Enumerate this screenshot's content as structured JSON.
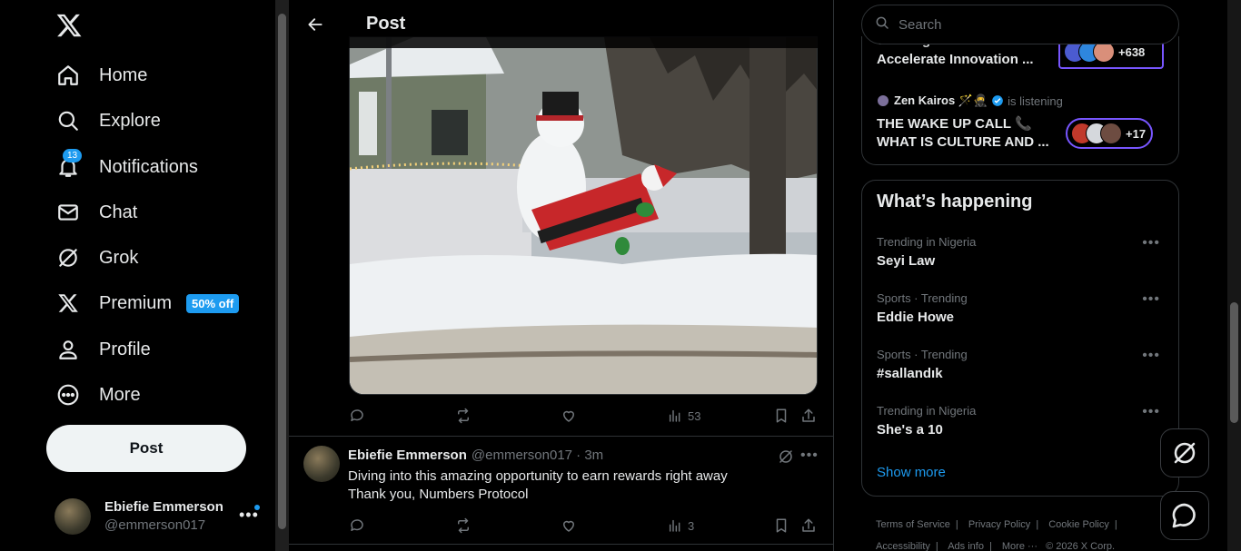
{
  "nav": {
    "items": [
      {
        "label": "Home",
        "icon": "home-icon"
      },
      {
        "label": "Explore",
        "icon": "search-icon"
      },
      {
        "label": "Notifications",
        "icon": "bell-icon",
        "badge": "13"
      },
      {
        "label": "Chat",
        "icon": "mail-icon"
      },
      {
        "label": "Grok",
        "icon": "grok-icon"
      },
      {
        "label": "Premium",
        "icon": "x-icon",
        "promo": "50% off"
      },
      {
        "label": "Profile",
        "icon": "person-icon"
      },
      {
        "label": "More",
        "icon": "more-circle-icon"
      }
    ],
    "post_button": "Post",
    "account": {
      "name": "Ebiefie Emmerson",
      "handle": "@emmerson017"
    }
  },
  "header": {
    "title": "Post"
  },
  "post": {
    "views": "53"
  },
  "reply": {
    "name": "Ebiefie Emmerson",
    "meta": "@emmerson017 · 3m",
    "text_line1": "Diving into this amazing opportunity to earn rewards right away",
    "text_line2": "Thank you, Numbers Protocol",
    "views": "3"
  },
  "search": {
    "placeholder": "Search"
  },
  "spaces": [
    {
      "title_partial": "Sell Regulation",
      "title": "Accelerate Innovation ...",
      "listeners": "+638"
    },
    {
      "host": "Zen Kairos 🪄🥷",
      "host_status": "is listening",
      "title_line1": "THE WAKE UP CALL 📞",
      "title_line2": "WHAT IS CULTURE AND ...",
      "listeners": "+17"
    }
  ],
  "happening": {
    "title": "What’s happening",
    "trends": [
      {
        "context": "Trending in Nigeria",
        "name": "Seyi Law"
      },
      {
        "context": "Sports · Trending",
        "name": "Eddie Howe"
      },
      {
        "context": "Sports · Trending",
        "name": "#sallandık"
      },
      {
        "context": "Trending in Nigeria",
        "name": "She's a 10"
      }
    ],
    "show_more": "Show more"
  },
  "footer": {
    "links": [
      "Terms of Service",
      "Privacy Policy",
      "Cookie Policy",
      "Accessibility",
      "Ads info",
      "More ···",
      "© 2026 X Corp."
    ]
  },
  "colors": {
    "accent": "#1d9bf0",
    "background": "#000000",
    "border": "#2f3336",
    "muted": "#71767b",
    "spaces_purple": "#7856ff"
  }
}
